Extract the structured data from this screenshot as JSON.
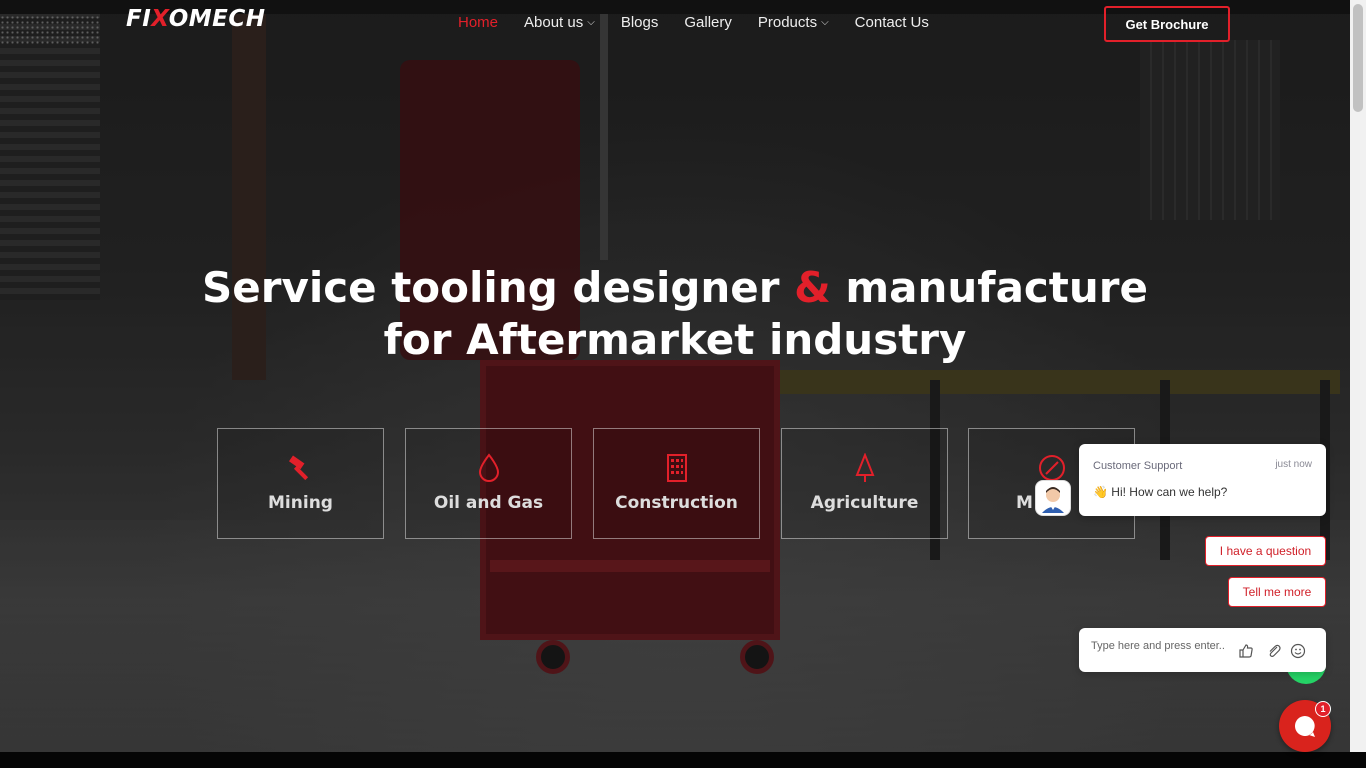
{
  "brand": {
    "logo_text_a": "FI",
    "logo_text_x": "X",
    "logo_text_b": "OMECH",
    "accent": "#e2202a"
  },
  "nav": {
    "items": [
      {
        "label": "Home",
        "active": true
      },
      {
        "label": "About us",
        "dropdown": true
      },
      {
        "label": "Blogs"
      },
      {
        "label": "Gallery"
      },
      {
        "label": "Products",
        "dropdown": true
      },
      {
        "label": "Contact Us"
      }
    ],
    "cta": "Get Brochure"
  },
  "hero": {
    "line1_a": "Service tooling designer ",
    "line1_amp": "&",
    "line1_b": " manufacture",
    "line2": "for Aftermarket industry"
  },
  "industries": [
    {
      "label": "Mining",
      "icon": "hammer-icon"
    },
    {
      "label": "Oil and Gas",
      "icon": "drop-icon"
    },
    {
      "label": "Construction",
      "icon": "building-icon"
    },
    {
      "label": "Agriculture",
      "icon": "tree-icon"
    },
    {
      "label": "M",
      "icon": "compass-icon"
    }
  ],
  "chat": {
    "title": "Customer Support",
    "time": "just now",
    "message": "👋 Hi! How can we help?",
    "quick_replies": [
      "I have a question",
      "Tell me more"
    ],
    "input_placeholder": "Type here and press enter..",
    "unread": "1"
  }
}
